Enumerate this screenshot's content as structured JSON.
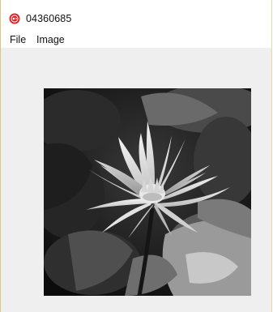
{
  "window": {
    "title": "04360685",
    "icon": "app-record-icon",
    "accent_color": "#e02020"
  },
  "menubar": {
    "items": [
      {
        "label": "File"
      },
      {
        "label": "Image"
      }
    ]
  },
  "canvas": {
    "image": "grayscale-water-lily-photo",
    "background_color": "#efefef"
  }
}
